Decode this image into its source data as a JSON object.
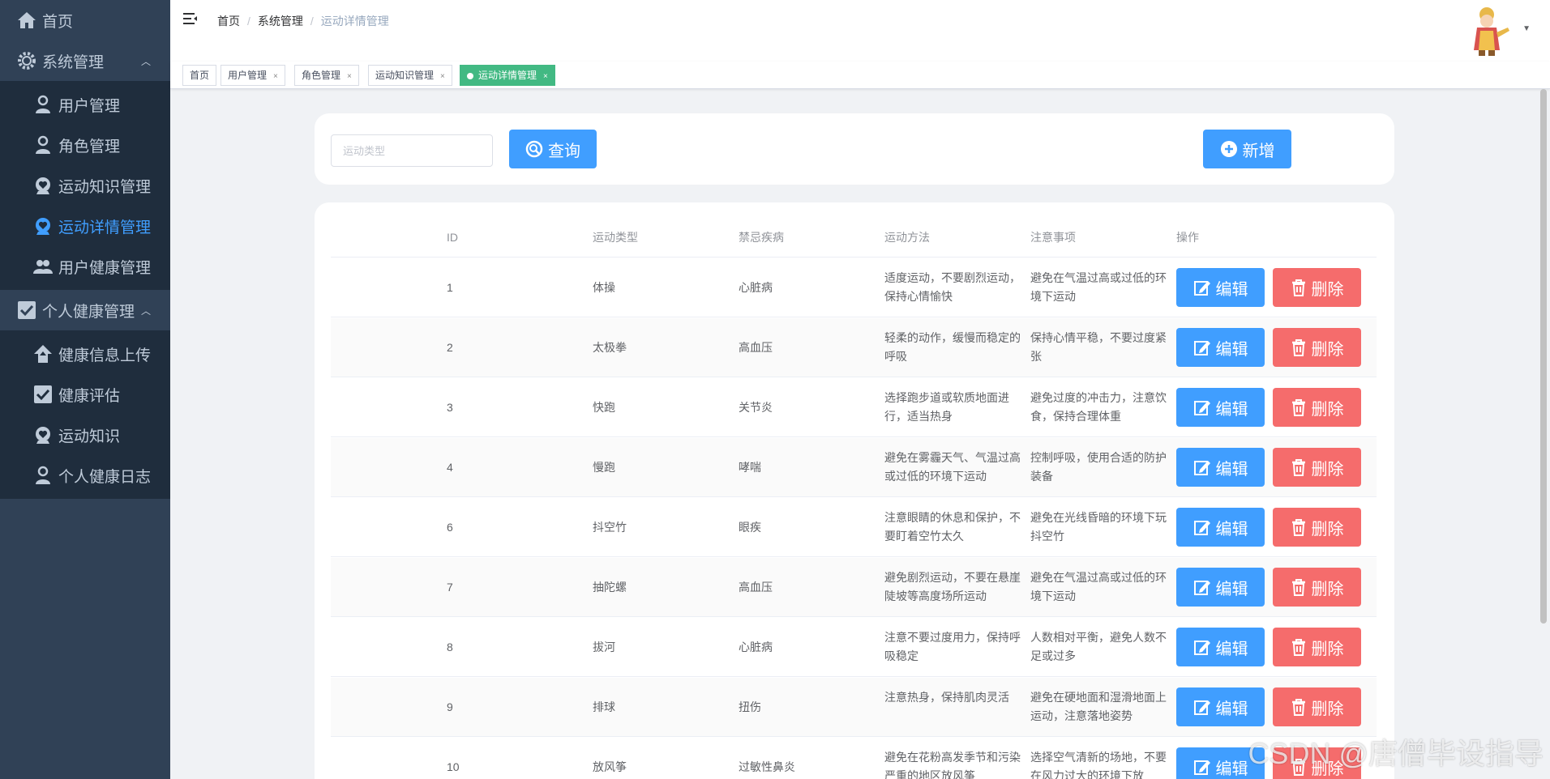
{
  "sidebar": {
    "home": "首页",
    "system": "系统管理",
    "system_items": [
      "用户管理",
      "角色管理",
      "运动知识管理",
      "运动详情管理",
      "用户健康管理"
    ],
    "personal": "个人健康管理",
    "personal_items": [
      "健康信息上传",
      "健康评估",
      "运动知识",
      "个人健康日志"
    ]
  },
  "breadcrumb": [
    "首页",
    "系统管理",
    "运动详情管理"
  ],
  "tags": [
    {
      "label": "首页",
      "closable": false
    },
    {
      "label": "用户管理",
      "closable": true
    },
    {
      "label": "角色管理",
      "closable": true
    },
    {
      "label": "运动知识管理",
      "closable": true
    },
    {
      "label": "运动详情管理",
      "closable": true,
      "active": true
    }
  ],
  "search": {
    "placeholder": "运动类型",
    "query_label": "查询",
    "add_label": "新增"
  },
  "table": {
    "headers": [
      "ID",
      "运动类型",
      "禁忌疾病",
      "运动方法",
      "注意事项",
      "操作"
    ],
    "edit_label": "编辑",
    "delete_label": "删除",
    "rows": [
      {
        "id": "1",
        "type": "体操",
        "disease": "心脏病",
        "method": "适度运动，不要剧烈运动，保持心情愉快",
        "note": "避免在气温过高或过低的环境下运动"
      },
      {
        "id": "2",
        "type": "太极拳",
        "disease": "高血压",
        "method": "轻柔的动作，缓慢而稳定的呼吸",
        "note": "保持心情平稳，不要过度紧张"
      },
      {
        "id": "3",
        "type": "快跑",
        "disease": "关节炎",
        "method": "选择跑步道或软质地面进行，适当热身",
        "note": "避免过度的冲击力，注意饮食，保持合理体重"
      },
      {
        "id": "4",
        "type": "慢跑",
        "disease": "哮喘",
        "method": "避免在雾霾天气、气温过高或过低的环境下运动",
        "note": "控制呼吸，使用合适的防护装备"
      },
      {
        "id": "6",
        "type": "抖空竹",
        "disease": "眼疾",
        "method": "注意眼睛的休息和保护，不要盯着空竹太久",
        "note": "避免在光线昏暗的环境下玩抖空竹"
      },
      {
        "id": "7",
        "type": "抽陀螺",
        "disease": "高血压",
        "method": "避免剧烈运动，不要在悬崖陡坡等高度场所运动",
        "note": "避免在气温过高或过低的环境下运动"
      },
      {
        "id": "8",
        "type": "拔河",
        "disease": "心脏病",
        "method": "注意不要过度用力，保持呼吸稳定",
        "note": "人数相对平衡，避免人数不足或过多"
      },
      {
        "id": "9",
        "type": "排球",
        "disease": "扭伤",
        "method": "注意热身，保持肌肉灵活",
        "note": "避免在硬地面和湿滑地面上运动，注意落地姿势"
      },
      {
        "id": "10",
        "type": "放风筝",
        "disease": "过敏性鼻炎",
        "method": "避免在花粉高发季节和污染严重的地区放风筝",
        "note": "选择空气清新的场地，不要在风力过大的环境下放"
      }
    ]
  },
  "watermark": "CSDN @唐僧毕设指导",
  "colors": {
    "sidebar": "#304156",
    "submenu": "#1f2d3d",
    "primary": "#409eff",
    "danger": "#f56c6c",
    "tag_active": "#42b983"
  }
}
